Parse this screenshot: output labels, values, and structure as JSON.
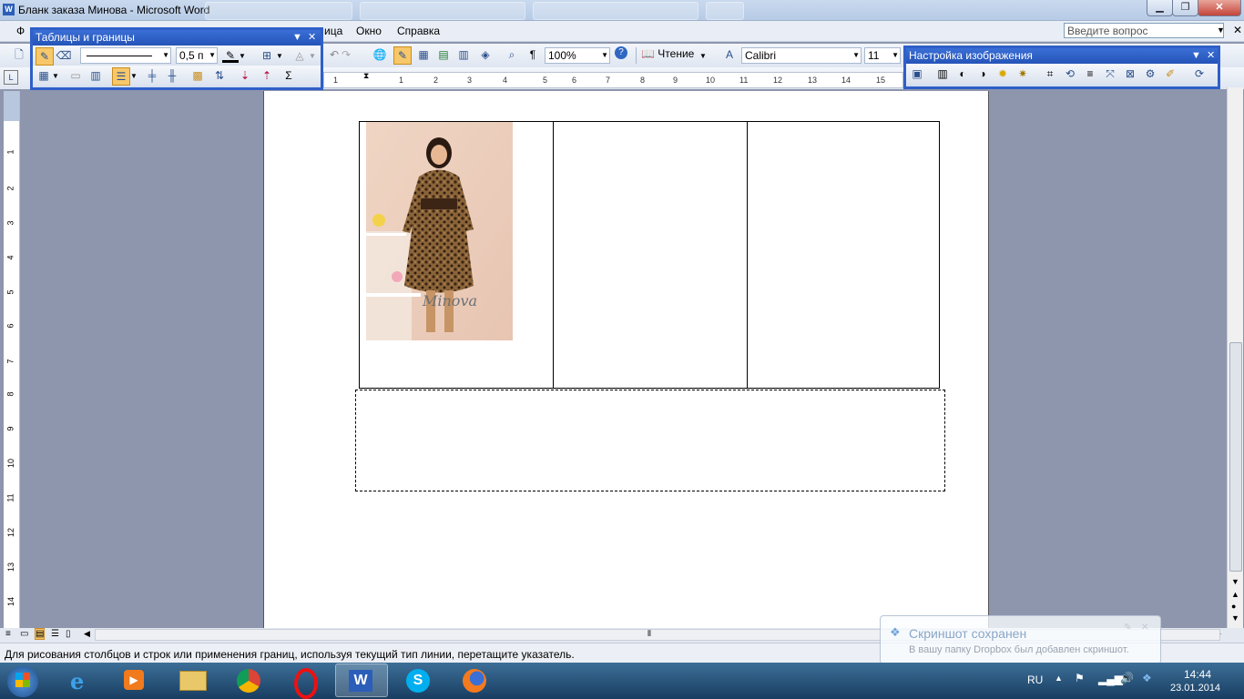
{
  "window": {
    "title": "Бланк заказа Минова - Microsoft Word",
    "min": "▁",
    "max": "❐",
    "close": "✕"
  },
  "menu": {
    "items": [
      "Ф",
      "ица",
      "Окно",
      "Справка"
    ],
    "ask_placeholder": "Введите вопрос"
  },
  "toolbar": {
    "zoom": "100%",
    "reading_label": "Чтение",
    "font": "Calibri",
    "font_size": "11",
    "pilcrow": "¶"
  },
  "palette_tables": {
    "title": "Таблицы и границы",
    "line_weight": "0,5 п",
    "sum": "Σ"
  },
  "palette_image": {
    "title": "Настройка изображения"
  },
  "ruler": {
    "h_numbers": [
      "1",
      "1",
      "2",
      "3",
      "4",
      "5",
      "6",
      "7",
      "8",
      "9",
      "10",
      "11",
      "12",
      "13",
      "14",
      "15"
    ],
    "v_numbers": [
      "1",
      "2",
      "3",
      "4",
      "5",
      "6",
      "7",
      "8",
      "9",
      "10",
      "11",
      "12",
      "13",
      "14"
    ]
  },
  "document": {
    "photo_watermark": "Minova"
  },
  "status": {
    "text": "Для рисования столбцов и строк или применения границ, используя текущий тип линии, перетащите указатель."
  },
  "notification": {
    "title": "Скриншот сохранен",
    "body": "В вашу папку Dropbox был добавлен скриншот."
  },
  "tray": {
    "lang": "RU",
    "time": "14:44",
    "date": "23.01.2014"
  },
  "colors": {
    "palette_border": "#2f5fc8",
    "taskbar": "#1f4a73",
    "page": "#ffffff",
    "workspace": "#8d96ad"
  }
}
